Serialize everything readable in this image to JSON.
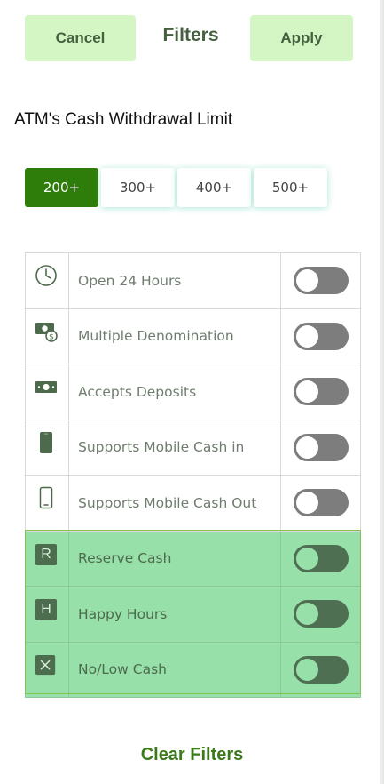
{
  "header": {
    "cancel_label": "Cancel",
    "title": "Filters",
    "apply_label": "Apply"
  },
  "limit_section": {
    "title": "ATM's Cash Withdrawal Limit",
    "options": [
      "200+",
      "300+",
      "400+",
      "500+"
    ],
    "selected": "200+"
  },
  "features": [
    {
      "label": "Open 24 Hours",
      "icon": "clock-icon",
      "enabled": false
    },
    {
      "label": "Multiple Denomination",
      "icon": "cash-coins-icon",
      "enabled": false
    },
    {
      "label": "Accepts Deposits",
      "icon": "banknote-icon",
      "enabled": false
    },
    {
      "label": "Supports Mobile Cash in",
      "icon": "phone-filled-icon",
      "enabled": false
    },
    {
      "label": "Supports Mobile Cash Out",
      "icon": "phone-outline-icon",
      "enabled": false
    },
    {
      "label": "Reserve Cash",
      "icon": "letter-r-icon",
      "badge": "R",
      "enabled": false
    },
    {
      "label": "Happy Hours",
      "icon": "letter-h-icon",
      "badge": "H",
      "enabled": false
    },
    {
      "label": "No/Low Cash",
      "icon": "x-box-icon",
      "enabled": false
    }
  ],
  "colors": {
    "accent": "#2e7d0a",
    "header_button_bg": "#d3f6c4",
    "highlight_bg": "#97e0a9",
    "clear_filters": "#3a7a1a"
  },
  "footer": {
    "clear_label": "Clear Filters"
  }
}
